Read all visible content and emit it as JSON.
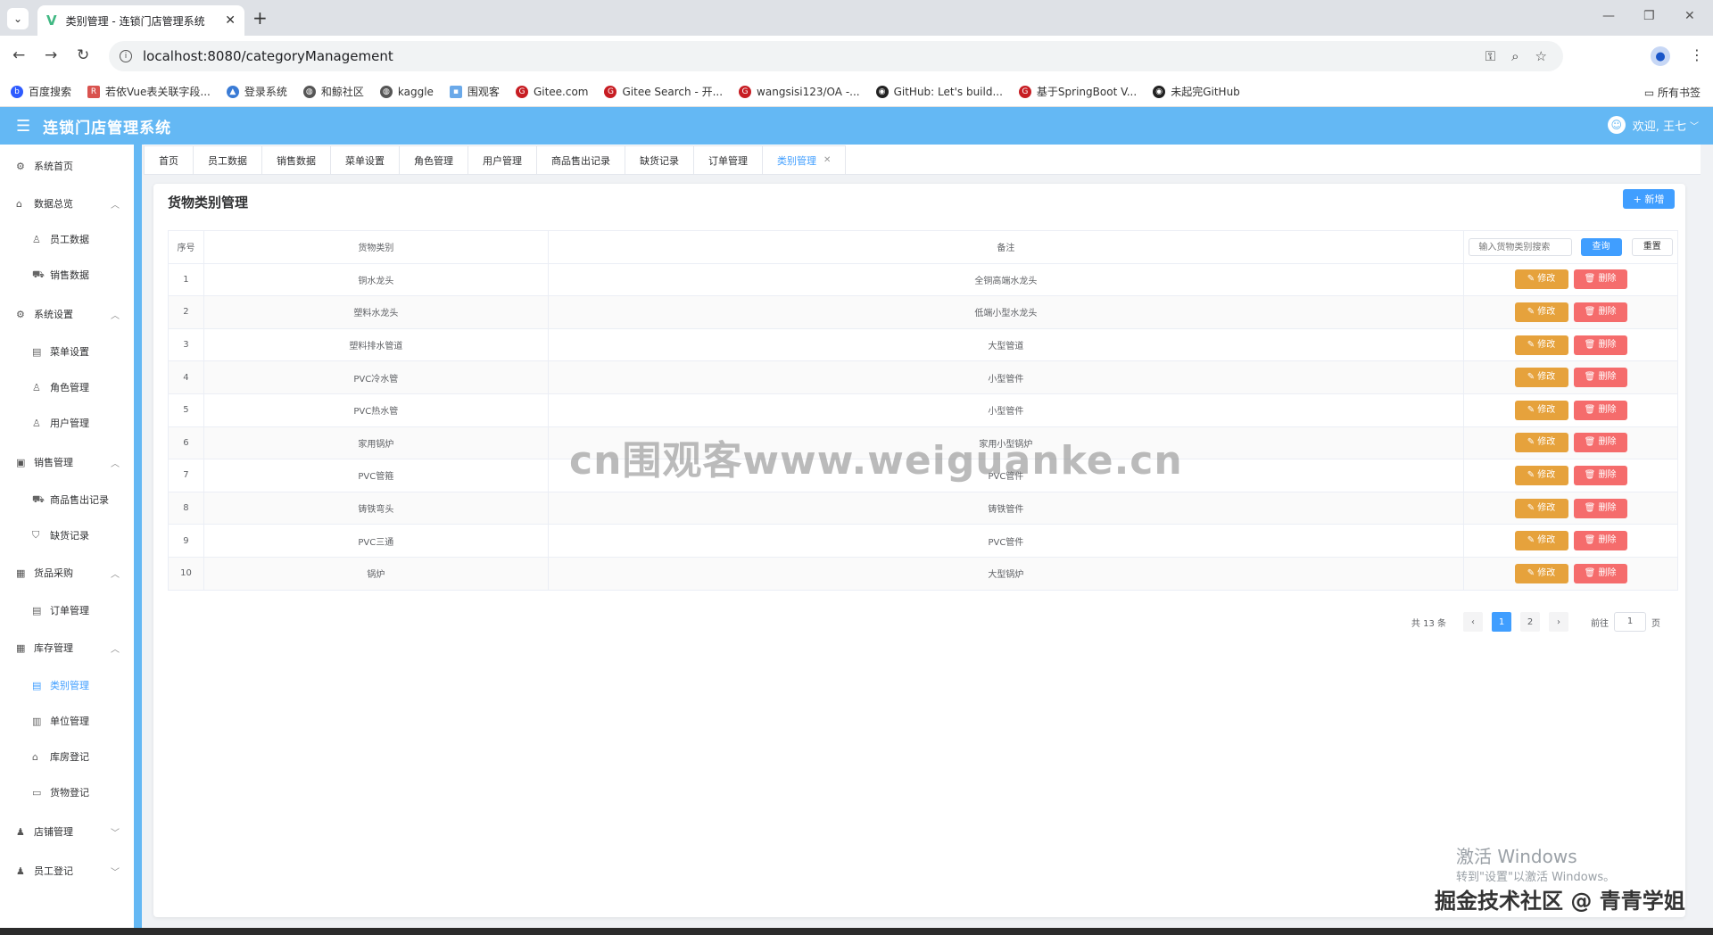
{
  "browser": {
    "tab_title": "类别管理 - 连锁门店管理系统",
    "url": "localhost:8080/categoryManagement",
    "bookmarks": [
      "百度搜索",
      "若依Vue表关联字段...",
      "登录系统",
      "和鲸社区",
      "kaggle",
      "围观客",
      "Gitee.com",
      "Gitee Search - 开...",
      "wangsisi123/OA -...",
      "GitHub: Let's build...",
      "基于SpringBoot V...",
      "未起完GitHub"
    ],
    "all_bookmarks": "所有书签"
  },
  "header": {
    "title": "连锁门店管理系统",
    "user": "欢迎, 王七"
  },
  "sidebar": {
    "home": "系统首页",
    "g1": "数据总览",
    "g1_i1": "员工数据",
    "g1_i2": "销售数据",
    "g2": "系统设置",
    "g2_i1": "菜单设置",
    "g2_i2": "角色管理",
    "g2_i3": "用户管理",
    "g3": "销售管理",
    "g3_i1": "商品售出记录",
    "g3_i2": "缺货记录",
    "g4": "货品采购",
    "g4_i1": "订单管理",
    "g5": "库存管理",
    "g5_i1": "类别管理",
    "g5_i2": "单位管理",
    "g5_i3": "库房登记",
    "g5_i4": "货物登记",
    "g6": "店铺管理",
    "g7": "员工登记"
  },
  "tags": [
    "首页",
    "员工数据",
    "销售数据",
    "菜单设置",
    "角色管理",
    "用户管理",
    "商品售出记录",
    "缺货记录",
    "订单管理",
    "类别管理"
  ],
  "card": {
    "title": "货物类别管理",
    "add_label": "+ 新增"
  },
  "table": {
    "headers": {
      "index": "序号",
      "category": "货物类别",
      "remark": "备注"
    },
    "search_placeholder": "输入货物类别搜索",
    "search_label": "查询",
    "reset_label": "重置",
    "edit_label": "✎ 修改",
    "delete_label": "🗑 删除",
    "rows": [
      {
        "index": "1",
        "category": "铜水龙头",
        "remark": "全铜高端水龙头"
      },
      {
        "index": "2",
        "category": "塑料水龙头",
        "remark": "低端小型水龙头"
      },
      {
        "index": "3",
        "category": "塑料排水管道",
        "remark": "大型管道"
      },
      {
        "index": "4",
        "category": "PVC冷水管",
        "remark": "小型管件"
      },
      {
        "index": "5",
        "category": "PVC热水管",
        "remark": "小型管件"
      },
      {
        "index": "6",
        "category": "家用锅炉",
        "remark": "家用小型锅炉"
      },
      {
        "index": "7",
        "category": "PVC管箍",
        "remark": "PVC管件"
      },
      {
        "index": "8",
        "category": "铸铁弯头",
        "remark": "铸铁管件"
      },
      {
        "index": "9",
        "category": "PVC三通",
        "remark": "PVC管件"
      },
      {
        "index": "10",
        "category": "锅炉",
        "remark": "大型锅炉"
      }
    ]
  },
  "pagination": {
    "total": "共 13 条",
    "pages": [
      "1",
      "2"
    ],
    "goto_label": "前往",
    "goto_value": "1",
    "unit": "页"
  },
  "overlay": {
    "watermark": "cn围观客www.weiguanke.cn",
    "win_line1": "激活 Windows",
    "win_line2": "转到\"设置\"以激活 Windows。",
    "juejin": "掘金技术社区 @ 青青学姐"
  },
  "colors": {
    "header": "#64b8f4",
    "primary": "#409eff",
    "warning": "#e6a23c",
    "danger": "#f56c6c"
  }
}
